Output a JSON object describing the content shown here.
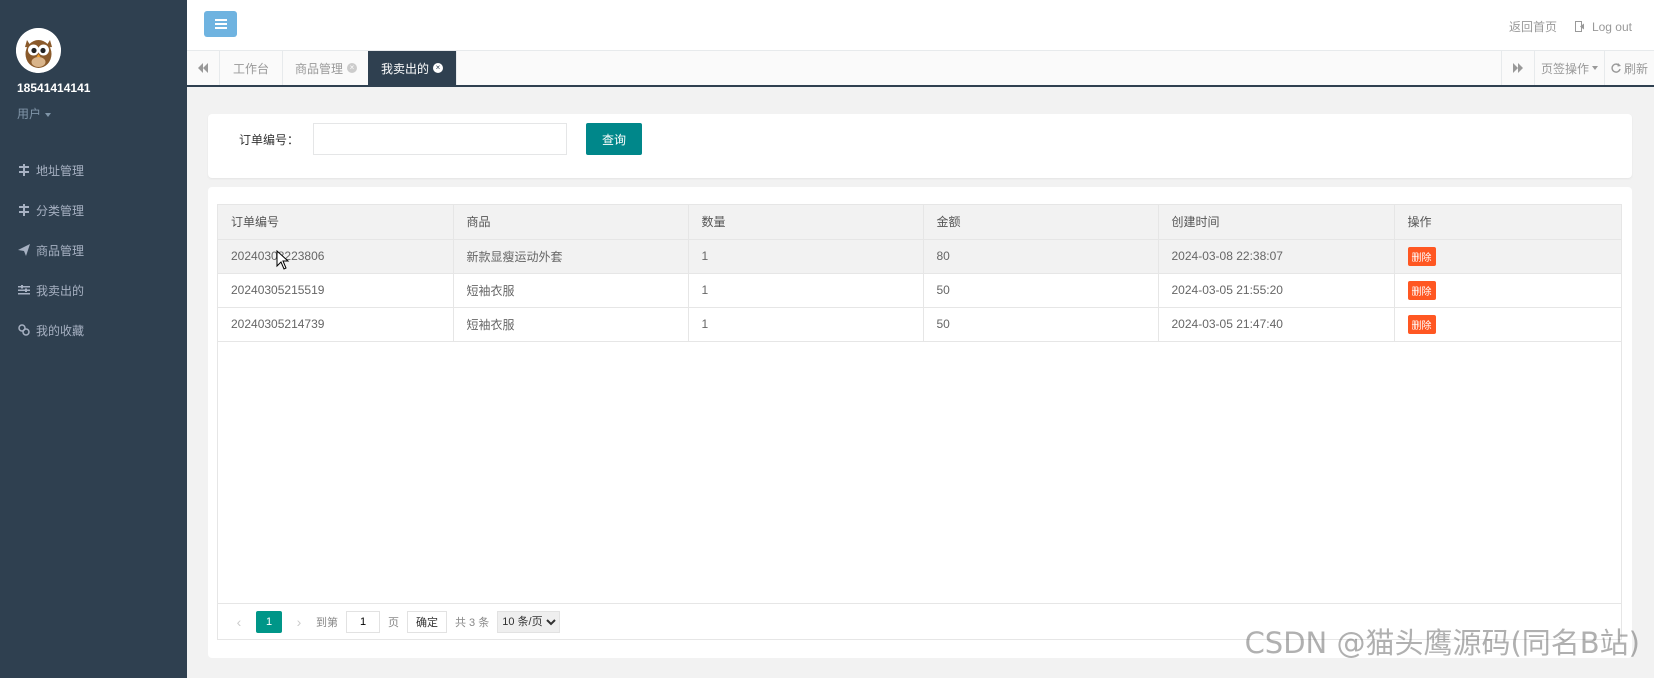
{
  "sidebar": {
    "username": "18541414141",
    "role": "用户",
    "items": [
      {
        "label": "地址管理",
        "icon": "address-icon"
      },
      {
        "label": "分类管理",
        "icon": "category-icon"
      },
      {
        "label": "商品管理",
        "icon": "send-icon"
      },
      {
        "label": "我卖出的",
        "icon": "sliders-icon"
      },
      {
        "label": "我的收藏",
        "icon": "link-icon"
      }
    ]
  },
  "header": {
    "home_link": "返回首页",
    "logout_link": "Log out"
  },
  "tabs": {
    "items": [
      {
        "label": "工作台"
      },
      {
        "label": "商品管理"
      },
      {
        "label": "我卖出的"
      }
    ],
    "tab_ops": "页签操作",
    "refresh": "刷新"
  },
  "search": {
    "label": "订单编号：",
    "value": "",
    "placeholder": "",
    "button": "查询"
  },
  "table": {
    "columns": [
      "订单编号",
      "商品",
      "数量",
      "金额",
      "创建时间",
      "操作"
    ],
    "rows": [
      {
        "order_no": "20240308223806",
        "product": "新款显瘦运动外套",
        "qty": "1",
        "amount": "80",
        "created": "2024-03-08 22:38:07",
        "action": "删除"
      },
      {
        "order_no": "20240305215519",
        "product": "短袖衣服",
        "qty": "1",
        "amount": "50",
        "created": "2024-03-05 21:55:20",
        "action": "删除"
      },
      {
        "order_no": "20240305214739",
        "product": "短袖衣服",
        "qty": "1",
        "amount": "50",
        "created": "2024-03-05 21:47:40",
        "action": "删除"
      }
    ]
  },
  "pager": {
    "current": "1",
    "goto_label": "到第",
    "goto_value": "1",
    "page_unit": "页",
    "confirm": "确定",
    "total": "共 3 条",
    "page_size": "10 条/页"
  },
  "watermark": "CSDN @猫头鹰源码(同名B站)",
  "colors": {
    "sidebar_bg": "#2f4050",
    "accent": "#00878a",
    "delete": "#ff5722",
    "menu_btn": "#6fb3e0"
  }
}
